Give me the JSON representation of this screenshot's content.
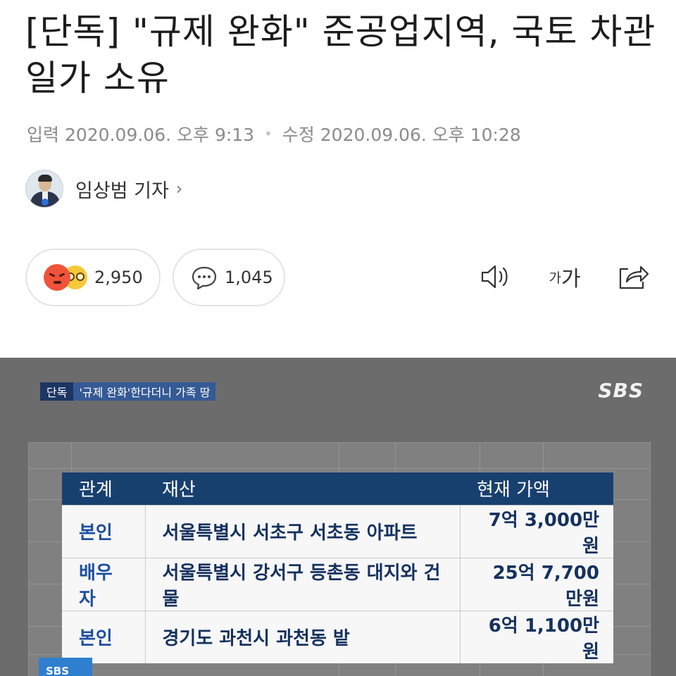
{
  "article": {
    "headline": "[단독] \"규제 완화\" 준공업지역, 국토 차관 일가 소유",
    "input_label": "입력",
    "input_time": "2020.09.06. 오후 9:13",
    "separator": "•",
    "edit_label": "수정",
    "edit_time": "2020.09.06. 오후 10:28"
  },
  "reporter": {
    "name": "임상범 기자",
    "chevron": "›"
  },
  "reactions": {
    "count": "2,950",
    "emoji_icons": [
      "angry-emoji-icon",
      "glasses-emoji-icon"
    ]
  },
  "comments": {
    "count": "1,045",
    "icon": "comment-bubble-icon"
  },
  "toolbar": {
    "font_small": "가",
    "font_large": "가",
    "icons": [
      "speaker-icon",
      "font-size-icon",
      "share-icon"
    ]
  },
  "video": {
    "caption_tag": "단독",
    "caption_text": "'규제 완화'한다더니 가족 땅",
    "broadcaster": "SBS",
    "corner_logo": "SBS",
    "table": {
      "headers": [
        "관계",
        "재산",
        "현재 가액"
      ],
      "rows": [
        [
          "본인",
          "서울특별시 서초구 서초동 아파트",
          "7억 3,000만원"
        ],
        [
          "배우자",
          "서울특별시 강서구 등촌동 대지와 건물",
          "25억 7,700만원"
        ],
        [
          "본인",
          "경기도 과천시 과천동 밭",
          "6억 1,100만원"
        ]
      ]
    }
  },
  "colors": {
    "table_header": "#18406f",
    "caption_tag": "#1c3563",
    "caption_text": "#355a94",
    "angry": "#f0533a"
  }
}
